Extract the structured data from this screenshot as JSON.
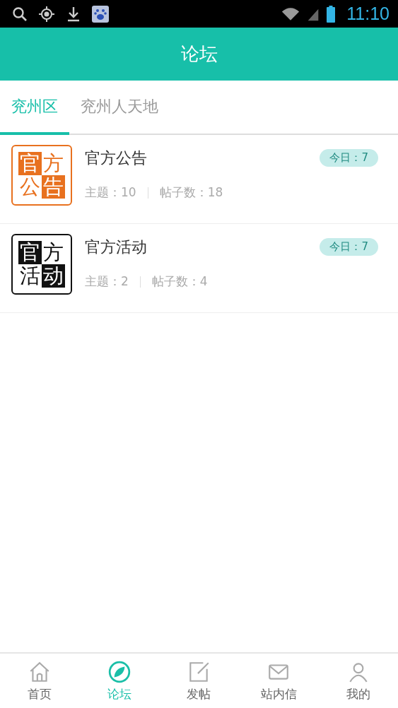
{
  "status_bar": {
    "time": "11:10"
  },
  "header": {
    "title": "论坛"
  },
  "tabs": [
    {
      "label": "兖州区",
      "selected": true
    },
    {
      "label": "兖州人天地",
      "selected": false
    }
  ],
  "forums": [
    {
      "title": "官方公告",
      "color": "#e8711f",
      "logo": [
        {
          "char": "官",
          "filled": true
        },
        {
          "char": "方",
          "filled": false
        },
        {
          "char": "公",
          "filled": false
        },
        {
          "char": "告",
          "filled": true
        }
      ],
      "today": "今日：7",
      "topics": "主题：10",
      "posts": "帖子数：18"
    },
    {
      "title": "官方活动",
      "color": "#111111",
      "logo": [
        {
          "char": "官",
          "filled": true
        },
        {
          "char": "方",
          "filled": false
        },
        {
          "char": "活",
          "filled": false
        },
        {
          "char": "动",
          "filled": true
        }
      ],
      "today": "今日：7",
      "topics": "主题：2",
      "posts": "帖子数：4"
    }
  ],
  "bottom_nav": [
    {
      "label": "首页",
      "kind": "home",
      "selected": false
    },
    {
      "label": "论坛",
      "kind": "forum",
      "selected": true
    },
    {
      "label": "发帖",
      "kind": "post",
      "selected": false
    },
    {
      "label": "站内信",
      "kind": "mail",
      "selected": false
    },
    {
      "label": "我的",
      "kind": "me",
      "selected": false
    }
  ]
}
